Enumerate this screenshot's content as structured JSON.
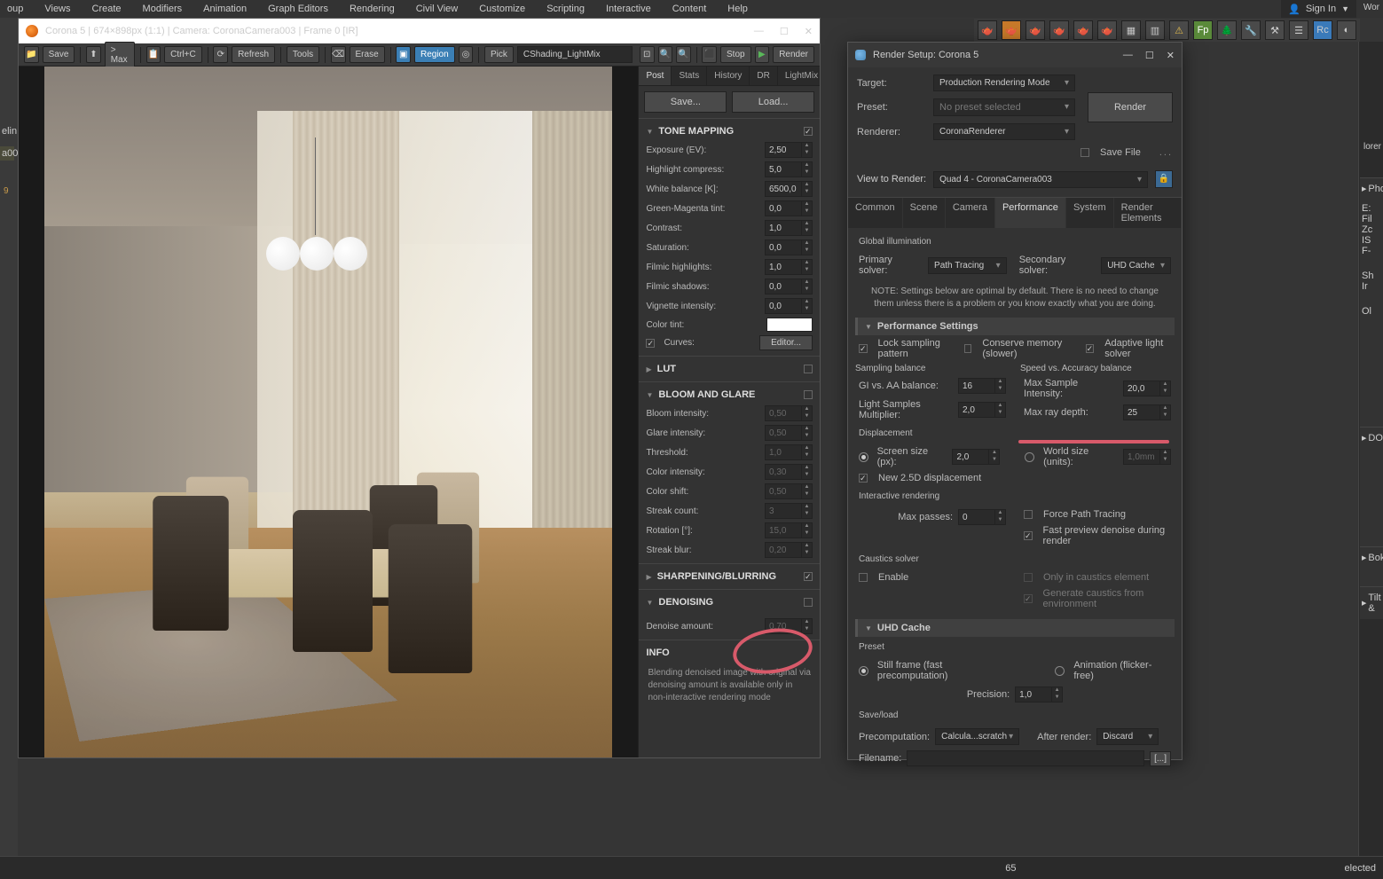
{
  "menubar": [
    "oup",
    "Views",
    "Create",
    "Modifiers",
    "Animation",
    "Graph Editors",
    "Rendering",
    "Civil View",
    "Customize",
    "Scripting",
    "Interactive",
    "Content",
    "Help"
  ],
  "signin": {
    "label": "Sign In",
    "icon": "👤"
  },
  "renderWindow": {
    "title": "Corona 5 | 674×898px (1:1) | Camera: CoronaCamera003 | Frame 0 [IR]",
    "toolbar": {
      "save": "Save",
      "max": "> Max",
      "ctrlc": "Ctrl+C",
      "refresh": "Refresh",
      "tools": "Tools",
      "erase": "Erase",
      "region": "Region",
      "pick": "Pick",
      "shading": "CShading_LightMix",
      "stop": "Stop",
      "render": "Render"
    },
    "tabs": [
      "Post",
      "Stats",
      "History",
      "DR",
      "LightMix"
    ],
    "buttons": {
      "save": "Save...",
      "load": "Load..."
    },
    "sections": {
      "toneMapping": {
        "title": "TONE MAPPING",
        "props": {
          "exposure": {
            "label": "Exposure (EV):",
            "val": "2,50"
          },
          "highlight": {
            "label": "Highlight compress:",
            "val": "5,0"
          },
          "whitebal": {
            "label": "White balance [K]:",
            "val": "6500,0"
          },
          "greenmag": {
            "label": "Green-Magenta tint:",
            "val": "0,0"
          },
          "contrast": {
            "label": "Contrast:",
            "val": "1,0"
          },
          "saturation": {
            "label": "Saturation:",
            "val": "0,0"
          },
          "filmicH": {
            "label": "Filmic highlights:",
            "val": "1,0"
          },
          "filmicS": {
            "label": "Filmic shadows:",
            "val": "0,0"
          },
          "vignette": {
            "label": "Vignette intensity:",
            "val": "0,0"
          },
          "colortint": {
            "label": "Color tint:"
          },
          "curves": {
            "label": "Curves:",
            "btn": "Editor..."
          }
        }
      },
      "lut": {
        "title": "LUT"
      },
      "bloom": {
        "title": "BLOOM AND GLARE",
        "props": {
          "bloomI": {
            "label": "Bloom intensity:",
            "val": "0,50"
          },
          "glareI": {
            "label": "Glare intensity:",
            "val": "0,50"
          },
          "thresh": {
            "label": "Threshold:",
            "val": "1,0"
          },
          "colorI": {
            "label": "Color intensity:",
            "val": "0,30"
          },
          "colorS": {
            "label": "Color shift:",
            "val": "0,50"
          },
          "streak": {
            "label": "Streak count:",
            "val": "3"
          },
          "rotation": {
            "label": "Rotation [°]:",
            "val": "15,0"
          },
          "blur": {
            "label": "Streak blur:",
            "val": "0,20"
          }
        }
      },
      "sharpen": {
        "title": "SHARPENING/BLURRING"
      },
      "denoise": {
        "title": "DENOISING",
        "amount": {
          "label": "Denoise amount:",
          "val": "0,70"
        }
      },
      "info": {
        "title": "INFO",
        "text": "Blending denoised image with original via denoising amount is available only in non-interactive rendering mode"
      }
    }
  },
  "renderSetup": {
    "title": "Render Setup: Corona 5",
    "top": {
      "target": {
        "label": "Target:",
        "val": "Production Rendering Mode"
      },
      "preset": {
        "label": "Preset:",
        "val": "No preset selected"
      },
      "renderer": {
        "label": "Renderer:",
        "val": "CoronaRenderer"
      },
      "saveFile": "Save File",
      "renderBtn": "Render",
      "viewLabel": "View to Render:",
      "viewVal": "Quad 4 - CoronaCamera003"
    },
    "tabs": [
      "Common",
      "Scene",
      "Camera",
      "Performance",
      "System",
      "Render Elements"
    ],
    "gi": {
      "title": "Global illumination",
      "primary": {
        "label": "Primary solver:",
        "val": "Path Tracing"
      },
      "secondary": {
        "label": "Secondary solver:",
        "val": "UHD Cache"
      },
      "note": "NOTE: Settings below are optimal by default. There is no need to change them unless there is a problem or you know exactly what you are doing."
    },
    "perf": {
      "title": "Performance Settings",
      "lock": "Lock sampling pattern",
      "conserve": "Conserve memory (slower)",
      "adaptive": "Adaptive light solver",
      "sampBal": "Sampling balance",
      "speedAcc": "Speed vs. Accuracy balance",
      "giaa": {
        "label": "GI vs. AA balance:",
        "val": "16"
      },
      "maxSamp": {
        "label": "Max Sample Intensity:",
        "val": "20,0"
      },
      "lightMult": {
        "label": "Light Samples Multiplier:",
        "val": "2,0"
      },
      "maxRay": {
        "label": "Max ray depth:",
        "val": "25"
      },
      "disp": "Displacement",
      "screenPx": {
        "label": "Screen size (px):",
        "val": "2,0"
      },
      "worldUnits": {
        "label": "World size (units):",
        "val": "1,0mm"
      },
      "new25d": "New 2.5D displacement",
      "interactive": "Interactive rendering",
      "maxPasses": {
        "label": "Max passes:",
        "val": "0"
      },
      "forcePath": "Force Path Tracing",
      "fastPreview": "Fast preview denoise during render",
      "caustics": "Caustics solver",
      "enable": "Enable",
      "onlyCaustics": "Only in caustics element",
      "genCaustics": "Generate caustics from environment"
    },
    "uhd": {
      "title": "UHD Cache",
      "preset": "Preset",
      "still": "Still frame (fast precomputation)",
      "anim": "Animation (flicker-free)",
      "precision": {
        "label": "Precision:",
        "val": "1,0"
      },
      "saveload": "Save/load",
      "precomp": {
        "label": "Precomputation:",
        "val": "Calcula...scratch"
      },
      "after": {
        "label": "After render:",
        "val": "Discard"
      },
      "filename": {
        "label": "Filename:",
        "btn": "[...]"
      }
    }
  },
  "rightDock": [
    "Phot",
    "DOF",
    "Boke",
    "Tilt &"
  ],
  "rightDockSub": [
    "E:",
    "Fil",
    "Zc",
    "IS",
    "F-",
    "Sh",
    "Ir",
    "Ol"
  ],
  "botStatus": "65",
  "leftNums": {
    "a": "elin",
    "b": "a00",
    "c": "9"
  }
}
